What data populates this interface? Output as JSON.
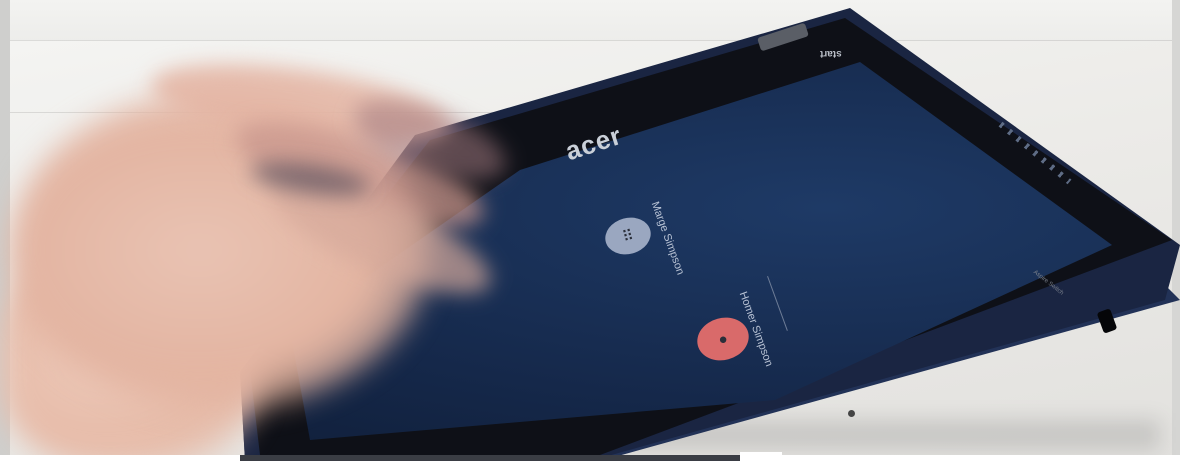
{
  "scene": {
    "device_brand": "acer",
    "device_small_brand": "start",
    "edge_label": "Aspire Switch",
    "screen": {
      "users": [
        {
          "name": "Marge Simpson",
          "avatar_icon": "user-grid-icon",
          "avatar_color": "#9aa7c0"
        },
        {
          "name": "Homer Simpson",
          "avatar_icon": "user-face-icon",
          "avatar_color": "#d96a6a"
        }
      ]
    }
  }
}
